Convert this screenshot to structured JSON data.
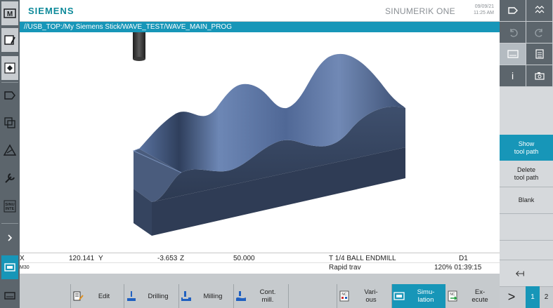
{
  "header": {
    "brand": "SIEMENS",
    "product": "SINUMERIK ONE",
    "date": "09/09/21",
    "time": "11:25 AM"
  },
  "path": "//USB_TOP:/My Siemens Stick/WAVE_TEST/WAVE_MAIN_PROG",
  "left_bar": {
    "items": [
      "machine-icon",
      "parameter-icon",
      "program-icon",
      "program-manager-icon",
      "diagnostics-icon",
      "warning-icon",
      "setup-icon",
      "sinumerik-icon"
    ]
  },
  "status": {
    "x_label": "X",
    "x_value": "120.141",
    "y_label": "Y",
    "y_value": "-3.653",
    "z_label": "Z",
    "z_value": "50.000",
    "tool": "T 1/4 BALL ENDMILL",
    "d": "D1",
    "mcode": "M30",
    "mode": "Rapid trav",
    "override_time": "120% 01:39:15"
  },
  "softkeys": {
    "edit": "Edit",
    "drilling": "Drilling",
    "milling": "Milling",
    "cont_mill_1": "Cont.",
    "cont_mill_2": "mill.",
    "various_1": "Vari-",
    "various_2": "ous",
    "simulation_1": "Simu-",
    "simulation_2": "lation",
    "execute_1": "Ex-",
    "execute_2": "ecute",
    "nc_badge": "NC"
  },
  "vertical_softkeys": {
    "show_tool_path_1": "Show",
    "show_tool_path_2": "tool path",
    "delete_tool_path_1": "Delete",
    "delete_tool_path_2": "tool path",
    "blank": "Blank"
  },
  "right_bar": {
    "info": "i",
    "next_label": ">",
    "page_1": "1",
    "page_2": "2",
    "sinumerik_text": "SINU INTE"
  },
  "colors": {
    "accent": "#1796b8",
    "brand": "#0e8a9a",
    "part": "#4d6282"
  }
}
